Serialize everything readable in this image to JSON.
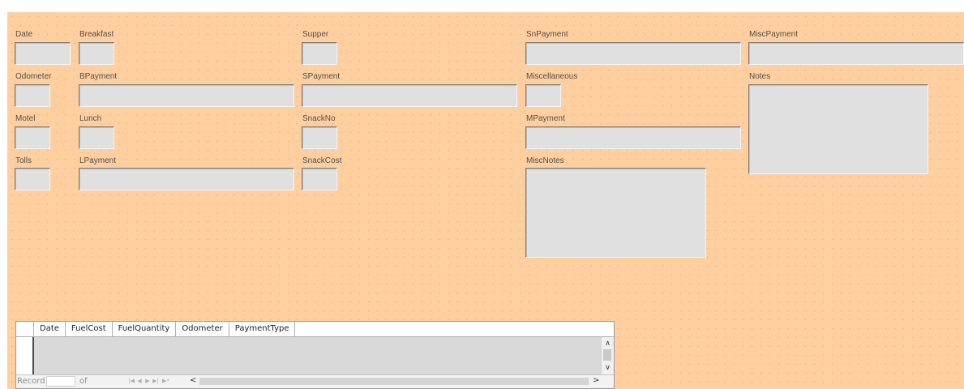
{
  "form": {
    "labels": {
      "date": "Date",
      "breakfast": "Breakfast",
      "supper": "Supper",
      "snpayment": "SnPayment",
      "miscpayment": "MiscPayment",
      "odometer": "Odometer",
      "bpayment": "BPayment",
      "spayment": "SPayment",
      "miscellaneous": "Miscellaneous",
      "notes": "Notes",
      "motel": "Motel",
      "lunch": "Lunch",
      "snackno": "SnackNo",
      "mpayment": "MPayment",
      "tolls": "Tolls",
      "lpayment": "LPayment",
      "snackcost": "SnackCost",
      "miscnotes": "MiscNotes"
    },
    "values": {
      "date": "",
      "breakfast": "",
      "supper": "",
      "snpayment": "",
      "miscpayment": "",
      "odometer": "",
      "bpayment": "",
      "spayment": "",
      "miscellaneous": "",
      "notes": "",
      "motel": "",
      "lunch": "",
      "snackno": "",
      "mpayment": "",
      "tolls": "",
      "lpayment": "",
      "snackcost": "",
      "miscnotes": ""
    }
  },
  "grid": {
    "columns": [
      "Date",
      "FuelCost",
      "FuelQuantity",
      "Odometer",
      "PaymentType"
    ],
    "navigator": {
      "record_label": "Record",
      "record_value": "",
      "of_label": "of",
      "total_value": ""
    }
  }
}
